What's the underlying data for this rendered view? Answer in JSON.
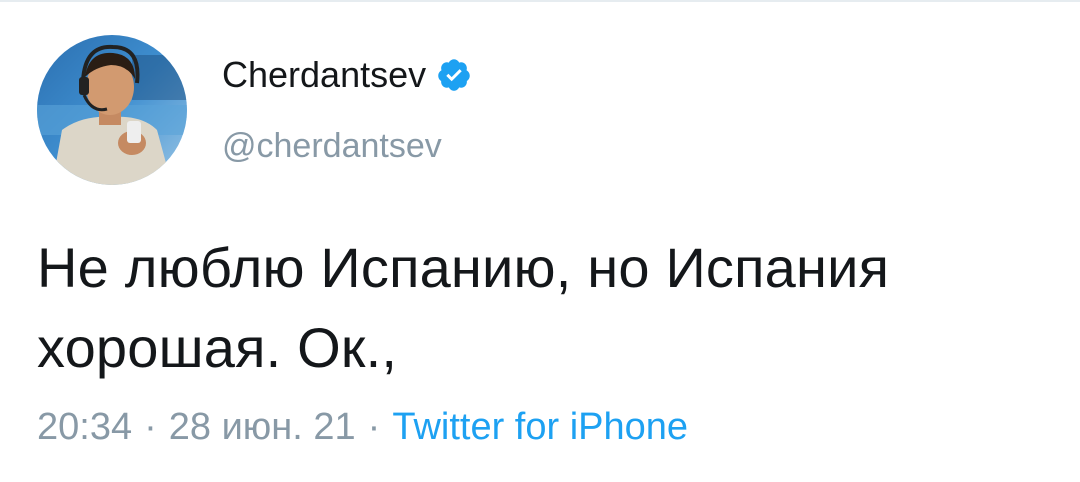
{
  "user": {
    "display_name": "Cherdantsev",
    "handle": "@cherdantsev",
    "verified": true
  },
  "tweet": {
    "text_line1": "Не люблю Испанию, но Испания",
    "text_line2": "хорошая. Ок.,",
    "time": "20:34",
    "date": "28 июн. 21",
    "separator": "·",
    "source": "Twitter for iPhone"
  },
  "colors": {
    "text_primary": "#14171a",
    "text_secondary": "#8899a6",
    "accent": "#1da1f2",
    "verified_badge": "#1da1f2"
  },
  "icons": {
    "verified": "verified-badge-icon"
  }
}
